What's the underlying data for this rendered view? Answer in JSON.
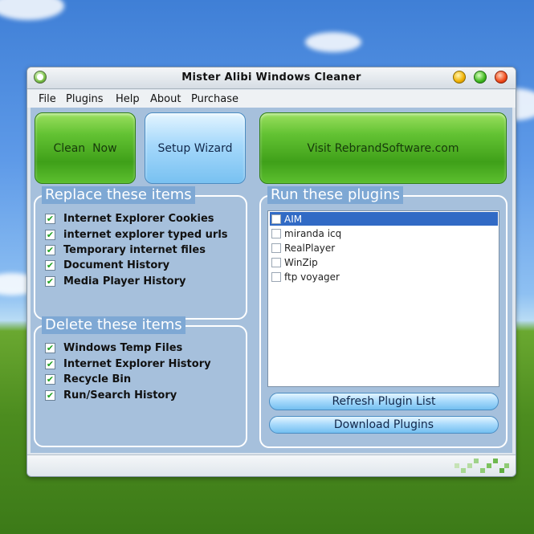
{
  "window": {
    "title": "Mister Alibi Windows Cleaner"
  },
  "menu": [
    "File",
    "Plugins",
    "Help",
    "About",
    "Purchase"
  ],
  "buttons": {
    "clean_now": "Clean  Now",
    "setup_wizard": "Setup Wizard",
    "visit": "Visit RebrandSoftware.com"
  },
  "replace_group": {
    "title": "Replace these items",
    "items": [
      {
        "label": "Internet Explorer Cookies",
        "checked": true
      },
      {
        "label": "internet explorer typed urls",
        "checked": true
      },
      {
        "label": "Temporary internet files",
        "checked": true
      },
      {
        "label": "Document History",
        "checked": true
      },
      {
        "label": "Media Player History",
        "checked": true
      }
    ]
  },
  "delete_group": {
    "title": "Delete these items",
    "items": [
      {
        "label": "Windows Temp Files",
        "checked": true
      },
      {
        "label": "Internet Explorer History",
        "checked": true
      },
      {
        "label": "Recycle Bin",
        "checked": true
      },
      {
        "label": "Run/Search History",
        "checked": true
      }
    ]
  },
  "plugins_group": {
    "title": "Run these plugins",
    "items": [
      {
        "label": "AIM",
        "selected": true
      },
      {
        "label": "miranda icq",
        "selected": false
      },
      {
        "label": "RealPlayer",
        "selected": false
      },
      {
        "label": "WinZip",
        "selected": false
      },
      {
        "label": "ftp voyager",
        "selected": false
      }
    ],
    "refresh_label": "Refresh Plugin List",
    "download_label": "Download Plugins"
  },
  "colors": {
    "accent_green": "#3fa019",
    "accent_blue": "#78c1f1",
    "selection": "#316ac5"
  }
}
